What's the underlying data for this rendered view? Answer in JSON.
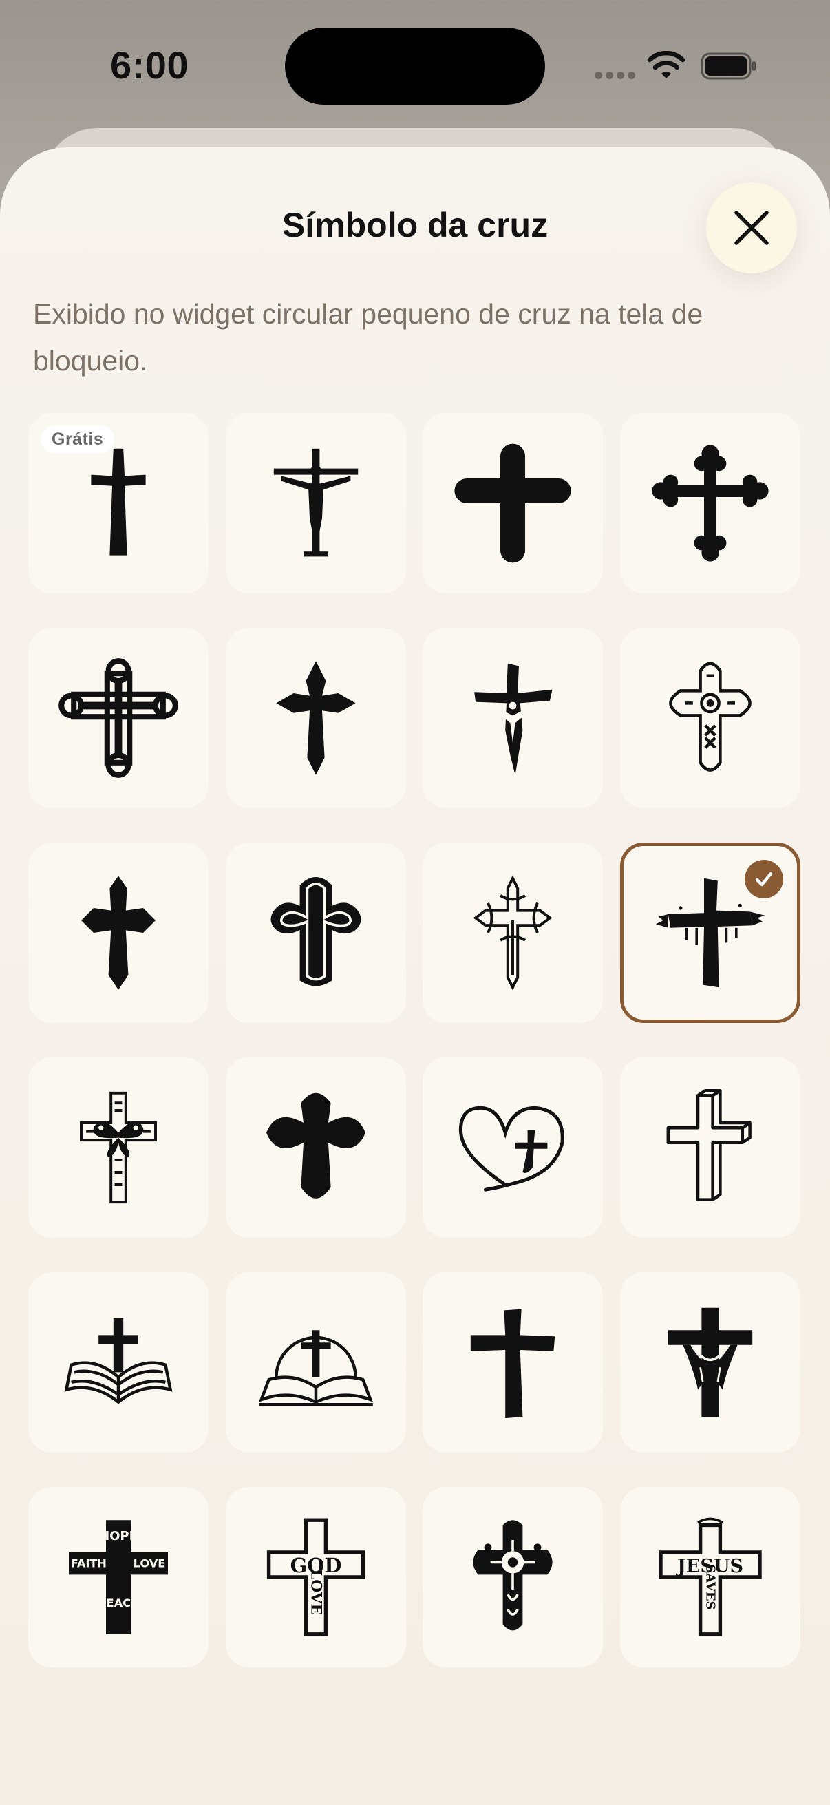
{
  "status_bar": {
    "time": "6:00"
  },
  "sheet": {
    "title": "Símbolo da cruz",
    "description": "Exibido no widget circular pequeno de cruz na tela de bloqueio."
  },
  "badges": {
    "free": "Grátis"
  },
  "selected_index": 11,
  "colors": {
    "accent": "#8a5a32",
    "sheet_background": "#f5f0e9",
    "tile_background": "#fbf8f1",
    "close_button_background": "#fbf7e4",
    "description_text": "#7c7166"
  },
  "symbols": [
    {
      "icon": "latin-cross-icon"
    },
    {
      "icon": "crucifix-icon"
    },
    {
      "icon": "budded-cross-icon"
    },
    {
      "icon": "trefoil-cross-icon"
    },
    {
      "icon": "outlined-budded-cross-icon"
    },
    {
      "icon": "fleury-cross-icon"
    },
    {
      "icon": "rugged-crucifix-icon"
    },
    {
      "icon": "ornate-outline-cross-icon"
    },
    {
      "icon": "pointed-cross-icon"
    },
    {
      "icon": "rounded-cross-icon"
    },
    {
      "icon": "filigree-cross-icon"
    },
    {
      "icon": "grunge-cross-icon"
    },
    {
      "icon": "butterfly-cross-icon"
    },
    {
      "icon": "round-lobed-cross-icon"
    },
    {
      "icon": "heart-cross-icon"
    },
    {
      "icon": "3d-wooden-cross-icon"
    },
    {
      "icon": "bible-cross-icon"
    },
    {
      "icon": "bible-arch-cross-icon"
    },
    {
      "icon": "rough-cross-icon"
    },
    {
      "icon": "draped-cross-icon"
    },
    {
      "icon": "faith-typography-cross-icon"
    },
    {
      "icon": "god-love-cross-icon"
    },
    {
      "icon": "floral-cross-icon"
    },
    {
      "icon": "jesus-saves-cross-icon"
    }
  ],
  "cross_words": {
    "god_love": {
      "horizontal": "GOD",
      "vertical": "LOVE"
    },
    "jesus_saves": {
      "horizontal": "JESUS",
      "vertical": "SAVES"
    },
    "faith": {
      "left": "FAITH",
      "right": "LOVE",
      "top": "HOPE",
      "bottom": "PEACE"
    }
  }
}
